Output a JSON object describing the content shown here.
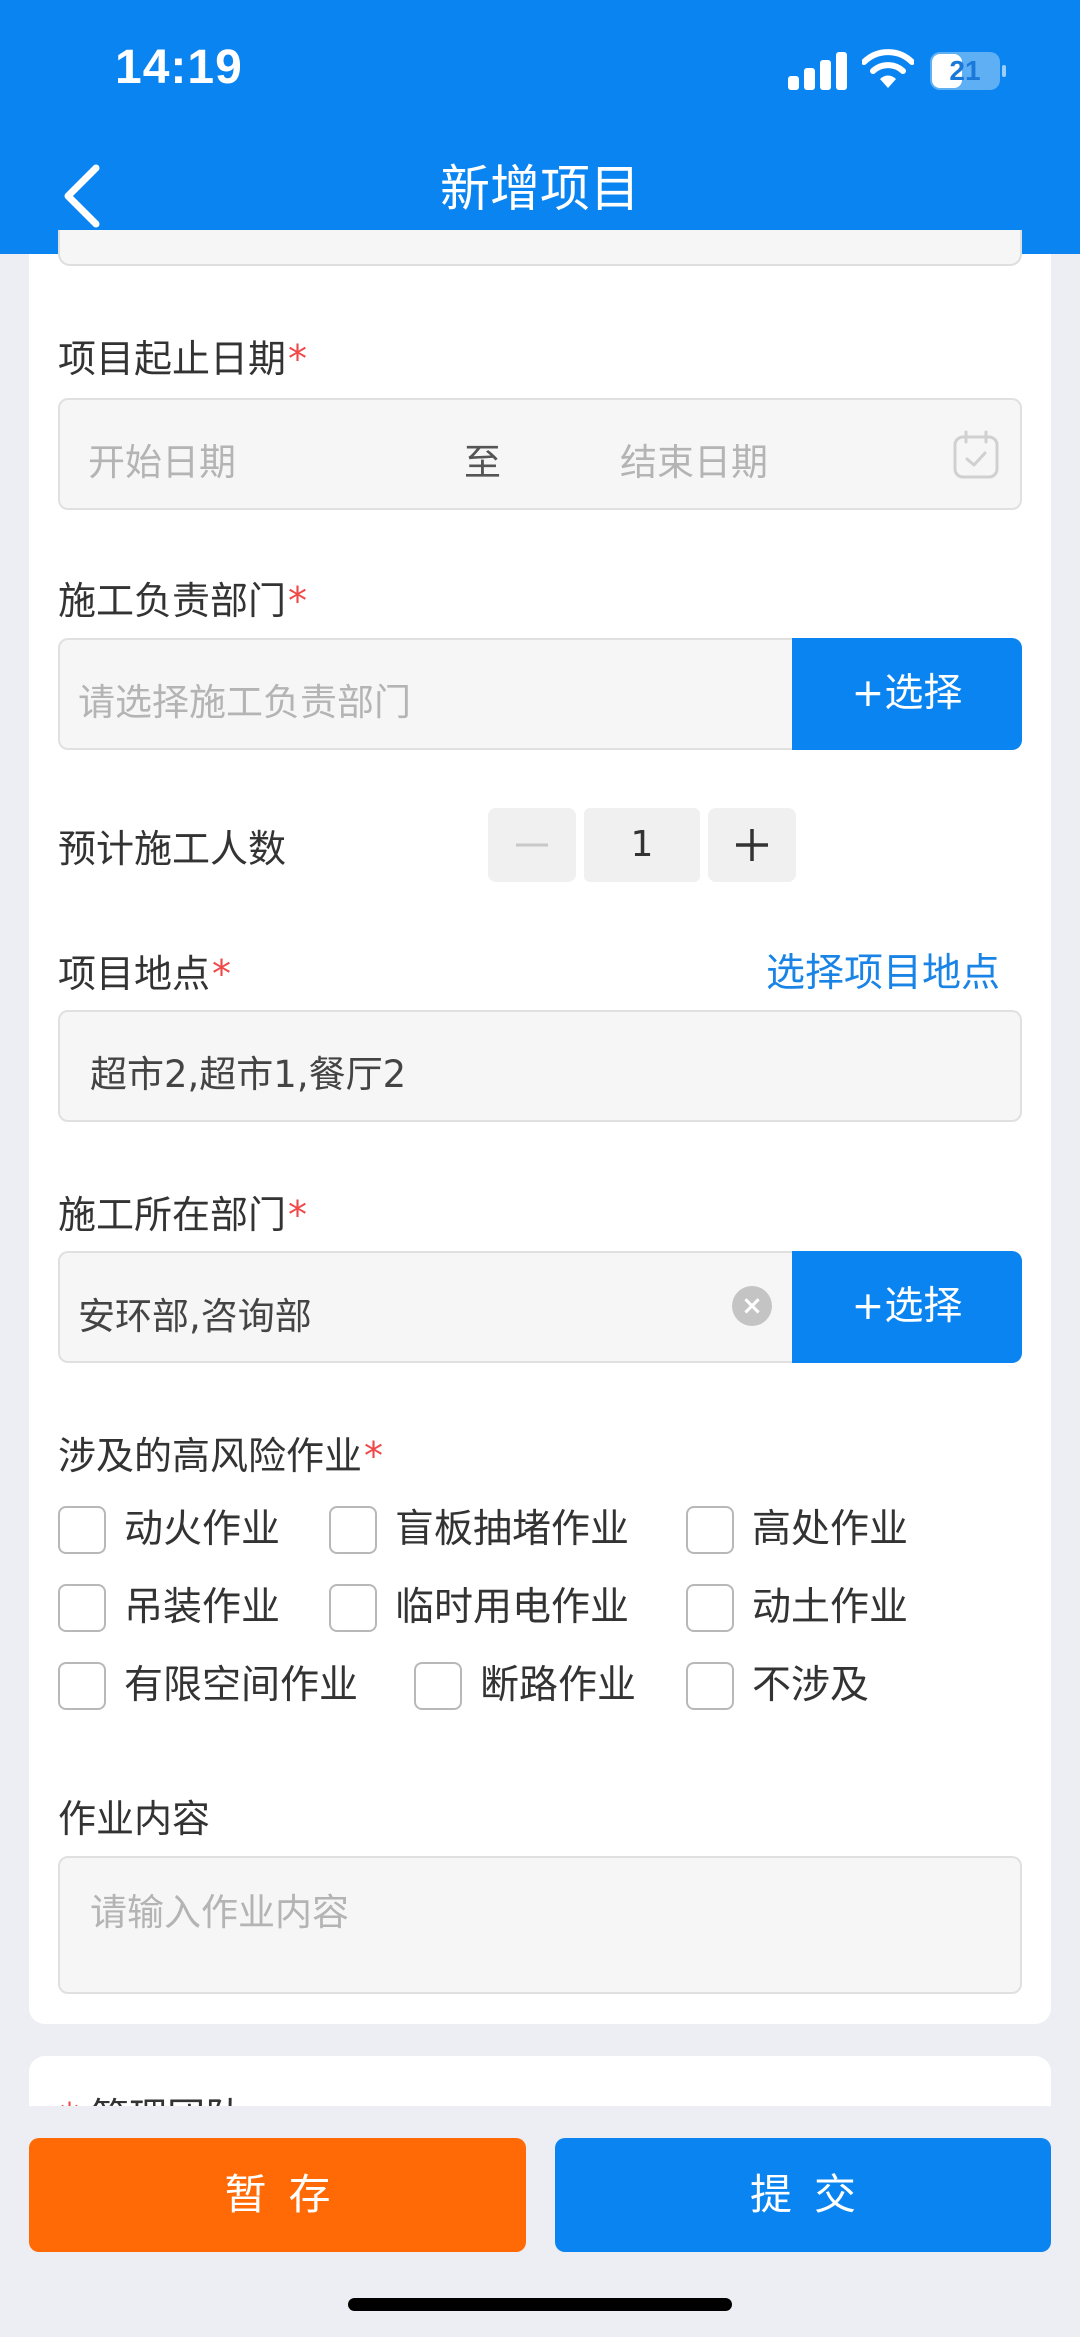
{
  "status_bar": {
    "time": "14:19",
    "battery": "21"
  },
  "header": {
    "title": "新增项目",
    "back_icon": "chevron-left-icon"
  },
  "form": {
    "date_range": {
      "label": "项目起止日期",
      "required_mark": "*",
      "start_placeholder": "开始日期",
      "separator": "至",
      "end_placeholder": "结束日期",
      "icon": "calendar-icon"
    },
    "construction_dept": {
      "label": "施工负责部门",
      "required_mark": "*",
      "placeholder": "请选择施工负责部门",
      "select_label": "+选择"
    },
    "headcount": {
      "label": "预计施工人数",
      "value": "1",
      "minus_icon": "minus-icon",
      "plus_icon": "plus-icon"
    },
    "location": {
      "label": "项目地点",
      "required_mark": "*",
      "link": "选择项目地点",
      "value": "超市2,超市1,餐厅2"
    },
    "located_dept": {
      "label": "施工所在部门",
      "required_mark": "*",
      "value": "安环部,咨询部",
      "select_label": "+选择",
      "clear_icon": "clear-icon"
    },
    "high_risk": {
      "label": "涉及的高风险作业",
      "required_mark": "*",
      "options": [
        {
          "label": "动火作业",
          "checked": false
        },
        {
          "label": "盲板抽堵作业",
          "checked": false
        },
        {
          "label": "高处作业",
          "checked": false
        },
        {
          "label": "吊装作业",
          "checked": false
        },
        {
          "label": "临时用电作业",
          "checked": false
        },
        {
          "label": "动土作业",
          "checked": false
        },
        {
          "label": "有限空间作业",
          "checked": false
        },
        {
          "label": "断路作业",
          "checked": false
        },
        {
          "label": "不涉及",
          "checked": false
        }
      ]
    },
    "work_content": {
      "label": "作业内容",
      "placeholder": "请输入作业内容"
    }
  },
  "next_section": {
    "required_mark": "*",
    "label": "管理团队"
  },
  "footer": {
    "save_label": "暂存",
    "submit_label": "提交"
  },
  "colors": {
    "primary": "#0a84f0",
    "save": "#ff6a06",
    "required": "#f04848",
    "link": "#1a84e6"
  }
}
